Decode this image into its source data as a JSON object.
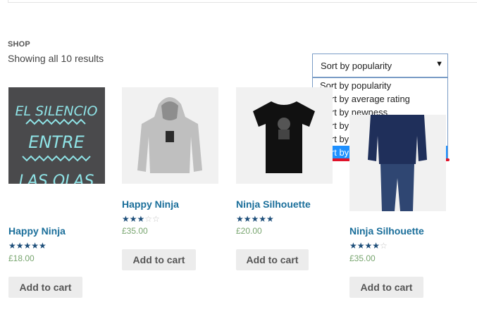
{
  "breadcrumb": "SHOP",
  "result_count": "Showing all 10 results",
  "sort": {
    "selected": "Sort by popularity",
    "arrow": "▼",
    "options": [
      "Sort by popularity",
      "Sort by average rating",
      "Sort by newness",
      "Sort by price: low to high",
      "Sort by price: high to low",
      "Sort by upcoming"
    ],
    "highlighted_index": 5,
    "highlight_color": "#1e90ff",
    "annotation_color": "#e0122a"
  },
  "products": [
    {
      "name": "Happy Ninja",
      "rating_stars": 5,
      "price": "£18.00",
      "button": "Add to cart",
      "image": "el-silencio-tshirt"
    },
    {
      "name": "Happy Ninja",
      "rating_stars": 3,
      "price": "£35.00",
      "button": "Add to cart",
      "image": "grey-hoodie"
    },
    {
      "name": "Ninja Silhouette",
      "rating_stars": 5,
      "price": "£20.00",
      "button": "Add to cart",
      "image": "black-tshirt"
    },
    {
      "name": "Ninja Silhouette",
      "rating_stars": 4,
      "price": "£35.00",
      "button": "Add to cart",
      "image": "man-in-hoodie"
    }
  ],
  "t1_line1": "EL SILENCIO",
  "t1_line2": "ENTRE",
  "t1_line3": "LAS OLAS"
}
